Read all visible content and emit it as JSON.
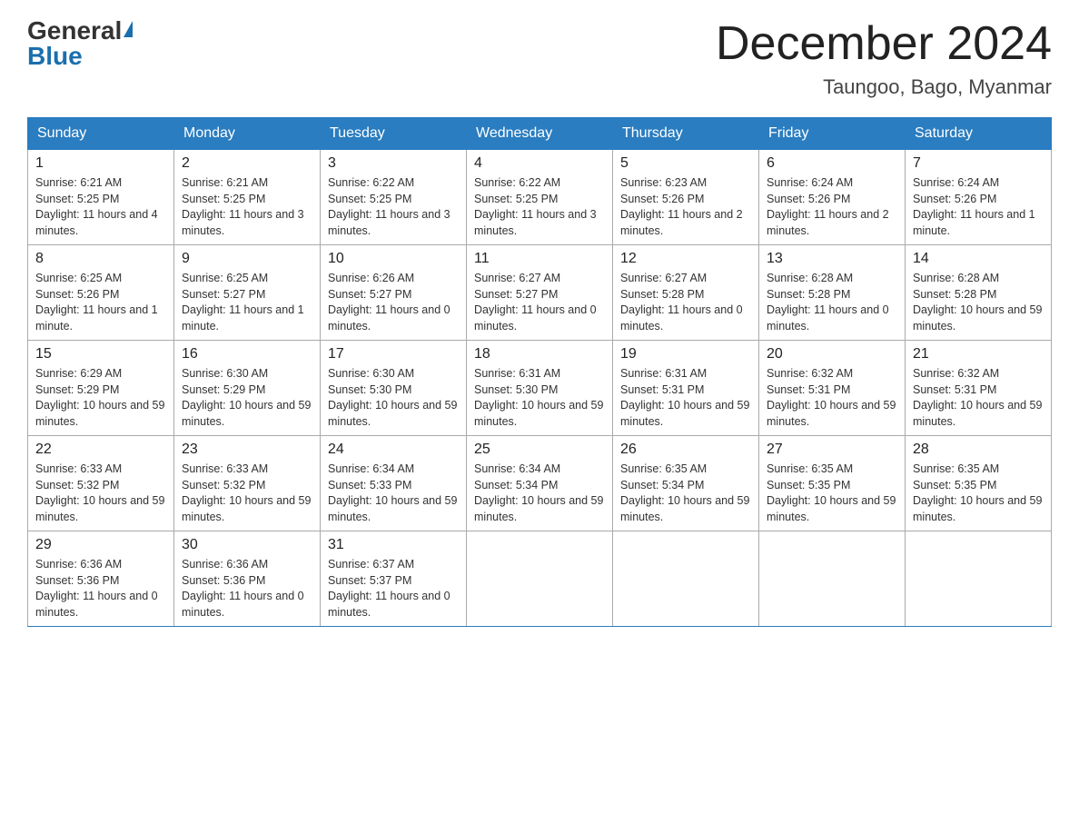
{
  "header": {
    "logo_general": "General",
    "logo_blue": "Blue",
    "month_title": "December 2024",
    "location": "Taungoo, Bago, Myanmar"
  },
  "days_of_week": [
    "Sunday",
    "Monday",
    "Tuesday",
    "Wednesday",
    "Thursday",
    "Friday",
    "Saturday"
  ],
  "weeks": [
    [
      {
        "day": "1",
        "sunrise": "6:21 AM",
        "sunset": "5:25 PM",
        "daylight": "11 hours and 4 minutes."
      },
      {
        "day": "2",
        "sunrise": "6:21 AM",
        "sunset": "5:25 PM",
        "daylight": "11 hours and 3 minutes."
      },
      {
        "day": "3",
        "sunrise": "6:22 AM",
        "sunset": "5:25 PM",
        "daylight": "11 hours and 3 minutes."
      },
      {
        "day": "4",
        "sunrise": "6:22 AM",
        "sunset": "5:25 PM",
        "daylight": "11 hours and 3 minutes."
      },
      {
        "day": "5",
        "sunrise": "6:23 AM",
        "sunset": "5:26 PM",
        "daylight": "11 hours and 2 minutes."
      },
      {
        "day": "6",
        "sunrise": "6:24 AM",
        "sunset": "5:26 PM",
        "daylight": "11 hours and 2 minutes."
      },
      {
        "day": "7",
        "sunrise": "6:24 AM",
        "sunset": "5:26 PM",
        "daylight": "11 hours and 1 minute."
      }
    ],
    [
      {
        "day": "8",
        "sunrise": "6:25 AM",
        "sunset": "5:26 PM",
        "daylight": "11 hours and 1 minute."
      },
      {
        "day": "9",
        "sunrise": "6:25 AM",
        "sunset": "5:27 PM",
        "daylight": "11 hours and 1 minute."
      },
      {
        "day": "10",
        "sunrise": "6:26 AM",
        "sunset": "5:27 PM",
        "daylight": "11 hours and 0 minutes."
      },
      {
        "day": "11",
        "sunrise": "6:27 AM",
        "sunset": "5:27 PM",
        "daylight": "11 hours and 0 minutes."
      },
      {
        "day": "12",
        "sunrise": "6:27 AM",
        "sunset": "5:28 PM",
        "daylight": "11 hours and 0 minutes."
      },
      {
        "day": "13",
        "sunrise": "6:28 AM",
        "sunset": "5:28 PM",
        "daylight": "11 hours and 0 minutes."
      },
      {
        "day": "14",
        "sunrise": "6:28 AM",
        "sunset": "5:28 PM",
        "daylight": "10 hours and 59 minutes."
      }
    ],
    [
      {
        "day": "15",
        "sunrise": "6:29 AM",
        "sunset": "5:29 PM",
        "daylight": "10 hours and 59 minutes."
      },
      {
        "day": "16",
        "sunrise": "6:30 AM",
        "sunset": "5:29 PM",
        "daylight": "10 hours and 59 minutes."
      },
      {
        "day": "17",
        "sunrise": "6:30 AM",
        "sunset": "5:30 PM",
        "daylight": "10 hours and 59 minutes."
      },
      {
        "day": "18",
        "sunrise": "6:31 AM",
        "sunset": "5:30 PM",
        "daylight": "10 hours and 59 minutes."
      },
      {
        "day": "19",
        "sunrise": "6:31 AM",
        "sunset": "5:31 PM",
        "daylight": "10 hours and 59 minutes."
      },
      {
        "day": "20",
        "sunrise": "6:32 AM",
        "sunset": "5:31 PM",
        "daylight": "10 hours and 59 minutes."
      },
      {
        "day": "21",
        "sunrise": "6:32 AM",
        "sunset": "5:31 PM",
        "daylight": "10 hours and 59 minutes."
      }
    ],
    [
      {
        "day": "22",
        "sunrise": "6:33 AM",
        "sunset": "5:32 PM",
        "daylight": "10 hours and 59 minutes."
      },
      {
        "day": "23",
        "sunrise": "6:33 AM",
        "sunset": "5:32 PM",
        "daylight": "10 hours and 59 minutes."
      },
      {
        "day": "24",
        "sunrise": "6:34 AM",
        "sunset": "5:33 PM",
        "daylight": "10 hours and 59 minutes."
      },
      {
        "day": "25",
        "sunrise": "6:34 AM",
        "sunset": "5:34 PM",
        "daylight": "10 hours and 59 minutes."
      },
      {
        "day": "26",
        "sunrise": "6:35 AM",
        "sunset": "5:34 PM",
        "daylight": "10 hours and 59 minutes."
      },
      {
        "day": "27",
        "sunrise": "6:35 AM",
        "sunset": "5:35 PM",
        "daylight": "10 hours and 59 minutes."
      },
      {
        "day": "28",
        "sunrise": "6:35 AM",
        "sunset": "5:35 PM",
        "daylight": "10 hours and 59 minutes."
      }
    ],
    [
      {
        "day": "29",
        "sunrise": "6:36 AM",
        "sunset": "5:36 PM",
        "daylight": "11 hours and 0 minutes."
      },
      {
        "day": "30",
        "sunrise": "6:36 AM",
        "sunset": "5:36 PM",
        "daylight": "11 hours and 0 minutes."
      },
      {
        "day": "31",
        "sunrise": "6:37 AM",
        "sunset": "5:37 PM",
        "daylight": "11 hours and 0 minutes."
      },
      null,
      null,
      null,
      null
    ]
  ]
}
